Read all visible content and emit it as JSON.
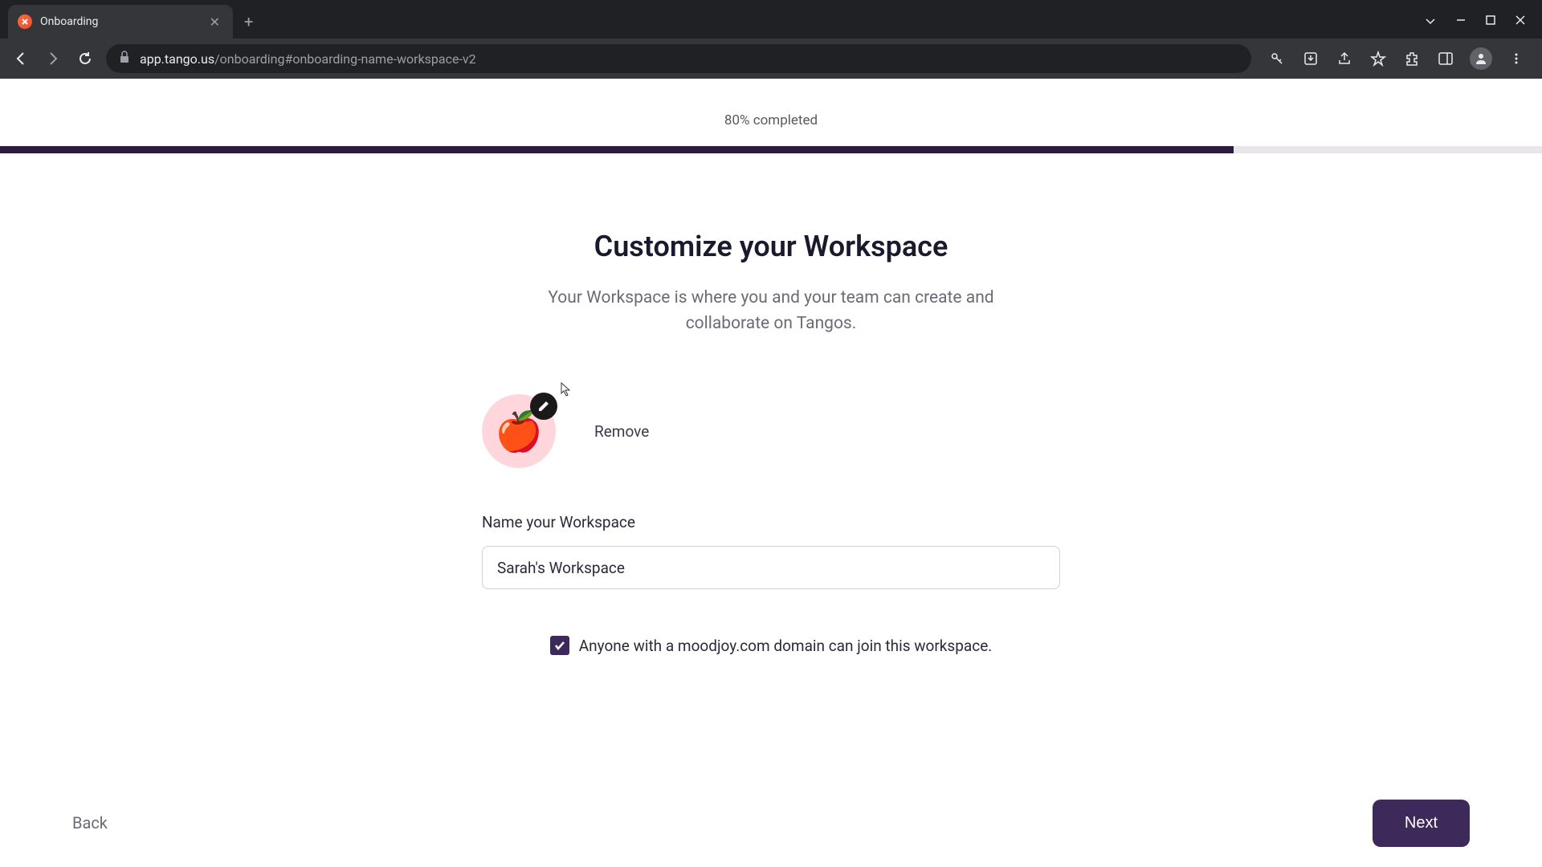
{
  "browser": {
    "tab_title": "Onboarding",
    "url_host": "app.tango.us",
    "url_path": "/onboarding#onboarding-name-workspace-v2"
  },
  "progress": {
    "label": "80% completed",
    "percent": 80
  },
  "heading": {
    "title": "Customize your Workspace",
    "subtitle": "Your Workspace is where you and your team can create and collaborate on Tangos."
  },
  "avatar": {
    "emoji": "🍎",
    "remove_label": "Remove"
  },
  "form": {
    "name_label": "Name your Workspace",
    "name_value": "Sarah's Workspace",
    "domain_join_label": "Anyone with a moodjoy.com domain can join this workspace."
  },
  "nav": {
    "back_label": "Back",
    "next_label": "Next"
  }
}
